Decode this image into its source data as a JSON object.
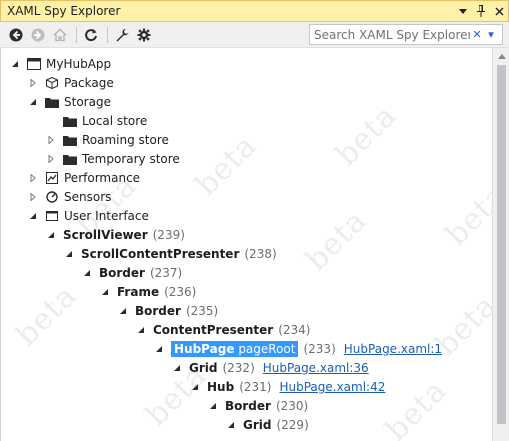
{
  "window": {
    "title": "XAML Spy Explorer",
    "buttons": [
      "dropdown-icon",
      "pin-icon",
      "close-icon"
    ]
  },
  "toolbar": {
    "buttons": [
      "back-icon",
      "forward-icon",
      "home-icon",
      "refresh-icon",
      "wrench-icon",
      "settings-icon"
    ],
    "search_placeholder": "Search XAML Spy Explorer",
    "search_clear": "✕",
    "search_dropdown": "▾"
  },
  "watermark_text": "beta",
  "tree": [
    {
      "label": "MyHubApp",
      "expanded": true,
      "icon": "window-icon"
    },
    {
      "label": "Package",
      "expanded": false,
      "icon": "package-icon"
    },
    {
      "label": "Storage",
      "expanded": true,
      "icon": "storage-icon"
    },
    {
      "label": "Local store",
      "icon": "folder-icon"
    },
    {
      "label": "Roaming store",
      "expanded": false,
      "icon": "folder-icon"
    },
    {
      "label": "Temporary store",
      "expanded": false,
      "icon": "folder-icon"
    },
    {
      "label": "Performance",
      "expanded": false,
      "icon": "chart-icon"
    },
    {
      "label": "Sensors",
      "expanded": false,
      "icon": "sensor-icon"
    },
    {
      "label": "User Interface",
      "expanded": true,
      "icon": "ui-icon"
    },
    {
      "label": "ScrollViewer",
      "count": "(239)"
    },
    {
      "label": "ScrollContentPresenter",
      "count": "(238)"
    },
    {
      "label": "Border",
      "count": "(237)"
    },
    {
      "label": "Frame",
      "count": "(236)"
    },
    {
      "label": "Border",
      "count": "(235)"
    },
    {
      "label": "ContentPresenter",
      "count": "(234)"
    },
    {
      "label": "HubPage",
      "name": "pageRoot",
      "count": "(233)",
      "link": "HubPage.xaml:1",
      "selected": true
    },
    {
      "label": "Grid",
      "count": "(232)",
      "link": "HubPage.xaml:36"
    },
    {
      "label": "Hub",
      "count": "(231)",
      "link": "HubPage.xaml:42"
    },
    {
      "label": "Border",
      "count": "(230)"
    },
    {
      "label": "Grid",
      "count": "(229)"
    }
  ]
}
